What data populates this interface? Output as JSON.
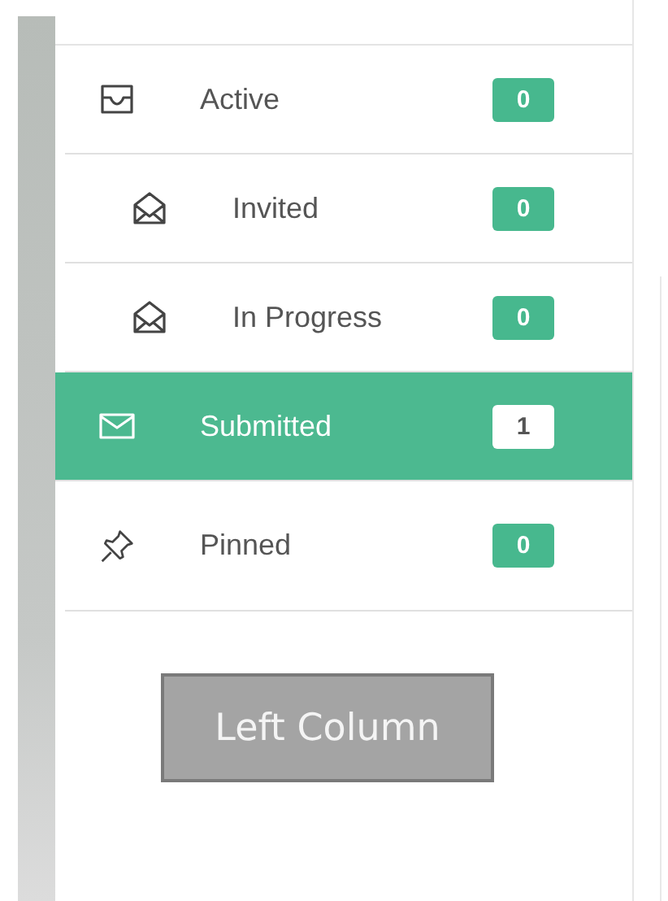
{
  "sidebar": {
    "items": [
      {
        "label": "Active",
        "count": "0",
        "selected": false,
        "children": [
          {
            "label": "Invited",
            "count": "0",
            "selected": false
          },
          {
            "label": "In Progress",
            "count": "0",
            "selected": false
          }
        ]
      },
      {
        "label": "Submitted",
        "count": "1",
        "selected": true
      },
      {
        "label": "Pinned",
        "count": "0",
        "selected": false
      }
    ]
  },
  "placeholder_box": {
    "label": "Left Column"
  }
}
